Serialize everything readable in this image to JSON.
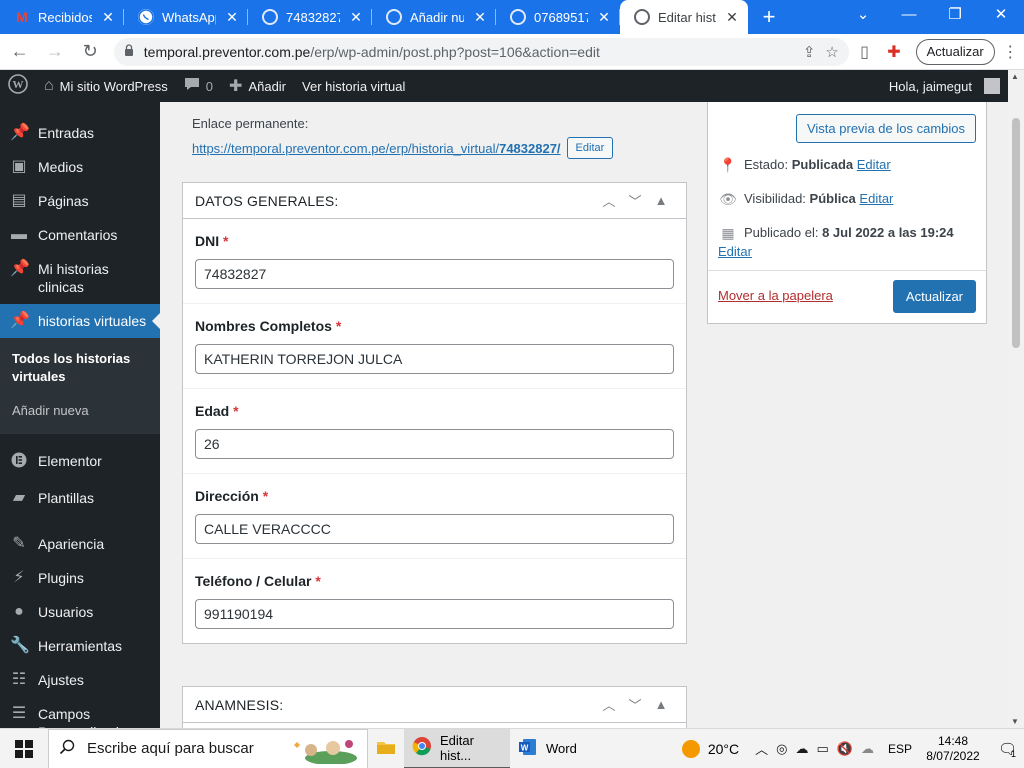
{
  "browser": {
    "tabs": [
      {
        "title": "Recibidos (",
        "favicon": "gmail-icon",
        "active": false
      },
      {
        "title": "WhatsApp",
        "favicon": "whatsapp-icon",
        "active": false
      },
      {
        "title": "74832827 -",
        "favicon": "globe-icon",
        "active": false
      },
      {
        "title": "Añadir nue",
        "favicon": "globe-icon",
        "active": false
      },
      {
        "title": "07689517 -",
        "favicon": "globe-icon",
        "active": false
      },
      {
        "title": "Editar histo",
        "favicon": "globe-icon",
        "active": true
      }
    ],
    "url_host": "temporal.preventor.com.pe",
    "url_path": "/erp/wp-admin/post.php?post=106&action=edit",
    "update_label": "Actualizar"
  },
  "adminbar": {
    "site_name": "Mi sitio WordPress",
    "comments_count": "0",
    "add_label": "Añadir",
    "view_label": "Ver historia virtual",
    "greeting": "Hola, jaimegut"
  },
  "sidebar": {
    "items": [
      {
        "label": "Entradas",
        "icon": "pin-icon"
      },
      {
        "label": "Medios",
        "icon": "media-icon"
      },
      {
        "label": "Páginas",
        "icon": "pages-icon"
      },
      {
        "label": "Comentarios",
        "icon": "comments-icon"
      },
      {
        "label": "Mi historias clinicas",
        "icon": "pin-icon"
      },
      {
        "label": "historias virtuales",
        "icon": "pin-icon",
        "active": true
      },
      {
        "label": "Elementor",
        "icon": "elementor-icon"
      },
      {
        "label": "Plantillas",
        "icon": "folder-icon"
      },
      {
        "label": "Apariencia",
        "icon": "brush-icon"
      },
      {
        "label": "Plugins",
        "icon": "plugin-icon"
      },
      {
        "label": "Usuarios",
        "icon": "user-icon"
      },
      {
        "label": "Herramientas",
        "icon": "wrench-icon"
      },
      {
        "label": "Ajustes",
        "icon": "settings-icon"
      },
      {
        "label": "Campos Personalizados",
        "icon": "list-icon"
      }
    ],
    "submenu": {
      "current": "Todos los historias virtuales",
      "add_new": "Añadir nueva"
    }
  },
  "permalink": {
    "label": "Enlace permanente:",
    "url_prefix": "https://temporal.preventor.com.pe/erp/historia_virtual/",
    "url_slug": "74832827/",
    "edit_label": "Editar"
  },
  "datos_generales": {
    "title": "DATOS GENERALES:",
    "fields": [
      {
        "label": "DNI",
        "required": "*",
        "value": "74832827"
      },
      {
        "label": "Nombres Completos",
        "required": "*",
        "value": "KATHERIN TORREJON JULCA"
      },
      {
        "label": "Edad",
        "required": "*",
        "value": "26"
      },
      {
        "label": "Dirección",
        "required": "*",
        "value": "CALLE VERACCCC"
      },
      {
        "label": "Teléfono / Celular",
        "required": "*",
        "value": "991190194"
      }
    ]
  },
  "anamnesis": {
    "title": "ANAMNESIS:"
  },
  "publish": {
    "preview_label": "Vista previa de los cambios",
    "status_label": "Estado:",
    "status_value": "Publicada",
    "visibility_label": "Visibilidad:",
    "visibility_value": "Pública",
    "published_label": "Publicado el:",
    "published_value": "8 Jul 2022 a las 19:24",
    "edit_label": "Editar",
    "trash_label": "Mover a la papelera",
    "update_label": "Actualizar"
  },
  "taskbar": {
    "search_placeholder": "Escribe aquí para buscar",
    "chrome_label": "Editar hist...",
    "word_label": "Word",
    "temperature": "20°C",
    "language": "ESP",
    "time": "14:48",
    "date": "8/07/2022",
    "notification_count": "1"
  },
  "colors": {
    "wp_blue": "#2271b1",
    "admin_dark": "#1d2327",
    "chrome_blue": "#1a73e8",
    "required_red": "#d63638"
  }
}
